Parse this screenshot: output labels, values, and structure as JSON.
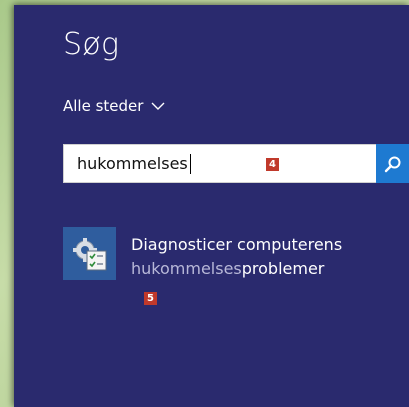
{
  "search_panel": {
    "title": "Søg",
    "scope_label": "Alle steder",
    "scope_icon": "chevron-down-icon",
    "search": {
      "value": "hukommelses",
      "search_icon": "search-icon"
    },
    "results": [
      {
        "title": "Diagnosticer computerens",
        "subtitle_match": "hukommelses",
        "subtitle_rest": "problemer",
        "icon": "memory-diagnostic-icon"
      }
    ]
  },
  "annotations": {
    "badge_search": "4",
    "badge_result": "5"
  },
  "colors": {
    "panel_bg": "#2a2a6e",
    "accent": "#1e7ad1",
    "badge": "#c0392b"
  }
}
